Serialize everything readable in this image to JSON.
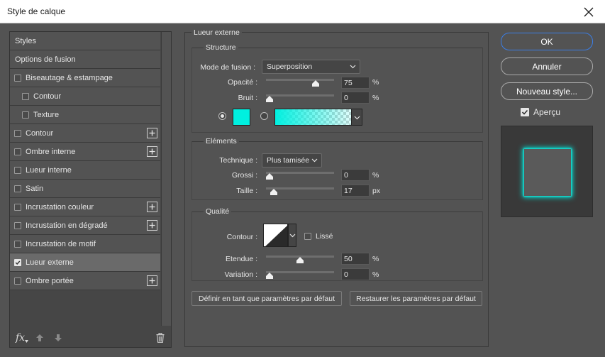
{
  "window": {
    "title": "Style de calque"
  },
  "styles_list": {
    "items": [
      {
        "label": "Styles",
        "has_checkbox": false,
        "checked": false,
        "has_plus": false,
        "indent": 0,
        "selected": false
      },
      {
        "label": "Options de fusion",
        "has_checkbox": false,
        "checked": false,
        "has_plus": false,
        "indent": 0,
        "selected": false
      },
      {
        "label": "Biseautage & estampage",
        "has_checkbox": true,
        "checked": false,
        "has_plus": false,
        "indent": 0,
        "selected": false
      },
      {
        "label": "Contour",
        "has_checkbox": true,
        "checked": false,
        "has_plus": false,
        "indent": 1,
        "selected": false
      },
      {
        "label": "Texture",
        "has_checkbox": true,
        "checked": false,
        "has_plus": false,
        "indent": 1,
        "selected": false
      },
      {
        "label": "Contour",
        "has_checkbox": true,
        "checked": false,
        "has_plus": true,
        "indent": 0,
        "selected": false
      },
      {
        "label": "Ombre interne",
        "has_checkbox": true,
        "checked": false,
        "has_plus": true,
        "indent": 0,
        "selected": false
      },
      {
        "label": "Lueur interne",
        "has_checkbox": true,
        "checked": false,
        "has_plus": false,
        "indent": 0,
        "selected": false
      },
      {
        "label": "Satin",
        "has_checkbox": true,
        "checked": false,
        "has_plus": false,
        "indent": 0,
        "selected": false
      },
      {
        "label": "Incrustation couleur",
        "has_checkbox": true,
        "checked": false,
        "has_plus": true,
        "indent": 0,
        "selected": false
      },
      {
        "label": "Incrustation en dégradé",
        "has_checkbox": true,
        "checked": false,
        "has_plus": true,
        "indent": 0,
        "selected": false
      },
      {
        "label": "Incrustation de motif",
        "has_checkbox": true,
        "checked": false,
        "has_plus": false,
        "indent": 0,
        "selected": false
      },
      {
        "label": "Lueur externe",
        "has_checkbox": true,
        "checked": true,
        "has_plus": false,
        "indent": 0,
        "selected": true
      },
      {
        "label": "Ombre portée",
        "has_checkbox": true,
        "checked": false,
        "has_plus": true,
        "indent": 0,
        "selected": false
      }
    ],
    "footer": {
      "fx_label": "fx",
      "fx_icon": "fx-icon",
      "up_icon": "arrow-up-icon",
      "down_icon": "arrow-down-icon",
      "trash_icon": "trash-icon"
    }
  },
  "outer_glow": {
    "title": "Lueur externe",
    "structure": {
      "title": "Structure",
      "blend_mode_label": "Mode de fusion :",
      "blend_mode_value": "Superposition",
      "opacity_label": "Opacité :",
      "opacity_value": "75",
      "opacity_unit": "%",
      "noise_label": "Bruit :",
      "noise_value": "0",
      "noise_unit": "%",
      "solid_color_selected": true,
      "glow_color": "#00f0e0",
      "opacity_fraction": 0.75,
      "noise_fraction": 0.0
    },
    "elements": {
      "title": "Eléments",
      "technique_label": "Technique :",
      "technique_value": "Plus tamisée",
      "spread_label": "Grossi :",
      "spread_value": "0",
      "spread_unit": "%",
      "size_label": "Taille :",
      "size_value": "17",
      "size_unit": "px",
      "spread_fraction": 0.0,
      "size_fraction": 0.07
    },
    "quality": {
      "title": "Qualité",
      "contour_label": "Contour :",
      "anti_alias_label": "Lissé",
      "anti_alias_checked": false,
      "range_label": "Etendue :",
      "range_value": "50",
      "range_unit": "%",
      "jitter_label": "Variation :",
      "jitter_value": "0",
      "jitter_unit": "%",
      "range_fraction": 0.5,
      "jitter_fraction": 0.0
    },
    "buttons": {
      "make_default": "Définir en tant que paramètres par défaut",
      "reset_default": "Restaurer les paramètres par défaut"
    }
  },
  "right": {
    "ok": "OK",
    "cancel": "Annuler",
    "new_style": "Nouveau style...",
    "preview_label": "Aperçu",
    "preview_checked": true,
    "accent_color": "#3b7ee6"
  }
}
